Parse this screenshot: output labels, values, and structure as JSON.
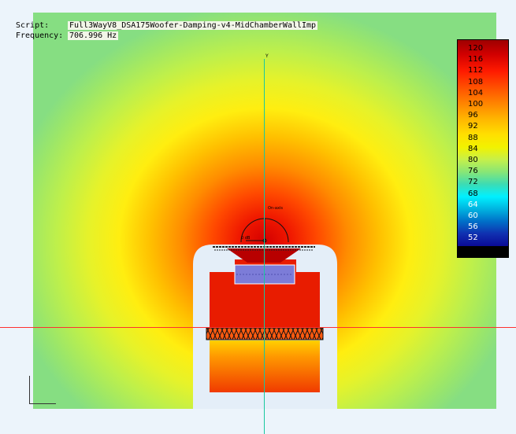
{
  "header": {
    "script_label": "Script:",
    "script_value": "Full3WayV8_DSA175Woofer-Damping-v4-MidChamberWallImp",
    "frequency_label": "Frequency:",
    "frequency_value": "706.996 Hz"
  },
  "colorbar": {
    "ticks": [
      "120",
      "116",
      "112",
      "108",
      "104",
      "100",
      "96",
      "92",
      "88",
      "84",
      "80",
      "76",
      "72",
      "68",
      "64",
      "60",
      "56",
      "52"
    ]
  },
  "annotations": {
    "y_axis": "Y",
    "on_axis": "On-axis",
    "angle": "0 dB"
  },
  "colors": {
    "baffle": "#e4eef8",
    "enclosure_red": "#e81c00",
    "driver_blue": "#7c7cd8",
    "axis_horizontal": "#ff3030",
    "axis_vertical": "#18c8a0"
  }
}
